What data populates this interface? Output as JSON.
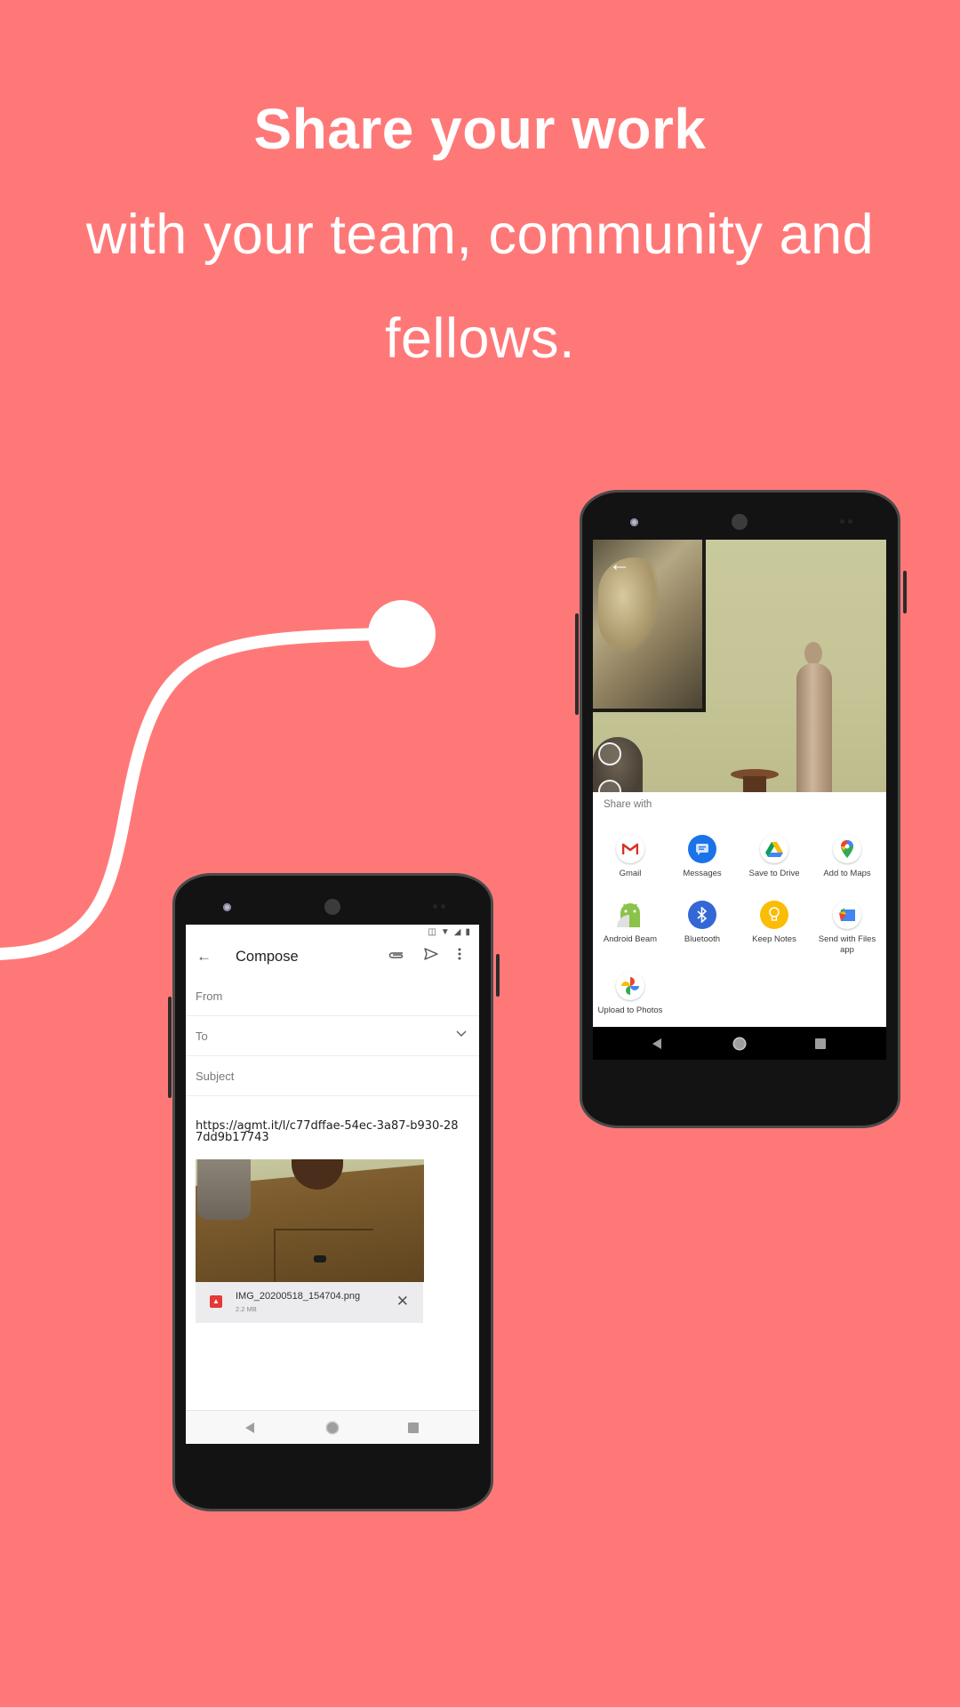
{
  "headline": {
    "title": "Share your work",
    "subtitle_line1": "with your team, community and",
    "subtitle_line2": "fellows."
  },
  "colors": {
    "background": "#ff7878",
    "accent_line": "#ffffff"
  },
  "share_phone": {
    "back_icon": "arrow-left-icon",
    "sheet_title": "Share with",
    "apps": [
      {
        "label": "Gmail",
        "icon": "gmail-icon"
      },
      {
        "label": "Messages",
        "icon": "messages-icon"
      },
      {
        "label": "Save to Drive",
        "icon": "google-drive-icon"
      },
      {
        "label": "Add to Maps",
        "icon": "google-maps-icon"
      },
      {
        "label": "Android Beam",
        "icon": "android-beam-icon"
      },
      {
        "label": "Bluetooth",
        "icon": "bluetooth-icon"
      },
      {
        "label": "Keep Notes",
        "icon": "keep-notes-icon"
      },
      {
        "label": "Send with Files app",
        "icon": "files-app-icon"
      },
      {
        "label": "Upload to Photos",
        "icon": "google-photos-icon"
      }
    ],
    "nav": [
      "back",
      "home",
      "recents"
    ]
  },
  "compose_phone": {
    "title": "Compose",
    "fields": {
      "from": "From",
      "to": "To",
      "subject": "Subject"
    },
    "body_link": "https://agmt.it/l/c77dffae-54ec-3a87-b930-287dd9b17743",
    "attachment": {
      "filename": "IMG_20200518_154704.png",
      "size": "2.2 MB"
    },
    "nav": [
      "back",
      "home",
      "recents"
    ]
  }
}
